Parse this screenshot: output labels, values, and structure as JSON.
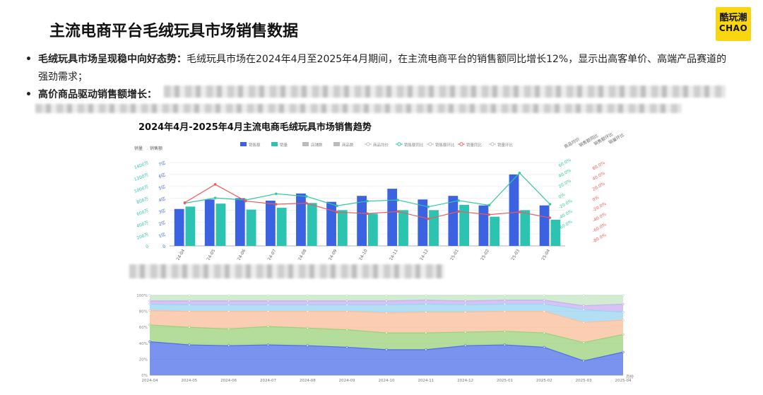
{
  "page": {
    "title": "主流电商平台毛绒玩具市场销售数据",
    "brand_logo": {
      "line1": "酷玩潮",
      "line2": "CHAO",
      "color": "#f8d711"
    },
    "bullets": [
      {
        "head": "毛绒玩具市场呈现稳中向好态势：",
        "text": "毛绒玩具市场在2024年4月至2025年4月期间，在主流电商平台的销售额同比增长12%，显示出高客单价、高端产品赛道的强劲需求；"
      },
      {
        "head": "高价商品驱动销售额增长：",
        "text": ""
      }
    ]
  },
  "chart_data": [
    {
      "type": "bar",
      "title": "2024年4月-2025年4月主流电商毛绒玩具市场销售趋势",
      "categories": [
        "2024-04",
        "2024-05",
        "2024-06",
        "2024-07",
        "2024-08",
        "2024-09",
        "2024-10",
        "2024-11",
        "2024-12",
        "2025-01",
        "2025-02",
        "2025-03",
        "2025-04"
      ],
      "legend": [
        "销售额",
        "销量",
        "店铺数",
        "商品数",
        "商品均价",
        "销售额同比",
        "销售额环比",
        "销量同比",
        "销量环比"
      ],
      "left_axes": [
        {
          "label": "销量",
          "ticks": [
            "0",
            "200万",
            "400万",
            "600万",
            "800万",
            "1000万",
            "1200万",
            "1400万"
          ],
          "color": "#2cc4b0"
        },
        {
          "label": "销售额",
          "ticks": [
            "0",
            "1亿",
            "2亿",
            "3亿",
            "4亿",
            "5亿",
            "6亿",
            "7亿"
          ],
          "color": "#3b62e0"
        }
      ],
      "right_axes": [
        {
          "label": "商品均价",
          "ticks": [],
          "color": "#888888"
        },
        {
          "label": "销售额同比",
          "ticks": [
            "-60.0%",
            "-40.0%",
            "-20.0%",
            "0%",
            "20.0%",
            "40.0%",
            "60.0%"
          ],
          "color": "#2fc9a0"
        },
        {
          "label": "销售额环比",
          "ticks": [
            "-80.0%",
            "-60.0%",
            "-40.0%",
            "-20.0%",
            "0%",
            "20.0%",
            "40.0%",
            "60.0%"
          ],
          "color": "#ee5a5a"
        },
        {
          "label": "销量环比",
          "ticks": [],
          "color": "#888888"
        }
      ],
      "series": [
        {
          "name": "销售额",
          "type": "bar",
          "color": "#3b62e0",
          "values": [
            3.1,
            3.9,
            4.0,
            3.8,
            4.4,
            3.7,
            4.2,
            4.8,
            3.9,
            4.2,
            3.4,
            6.0,
            3.4
          ]
        },
        {
          "name": "销量",
          "type": "bar",
          "color": "#2cc4b0",
          "values": [
            660,
            710,
            610,
            640,
            720,
            600,
            540,
            600,
            600,
            690,
            490,
            600,
            440
          ]
        },
        {
          "name": "销售额同比",
          "type": "line",
          "color": "#2fc9a0",
          "values": [
            2,
            12,
            8,
            20,
            15,
            -3,
            6,
            8,
            -5,
            7,
            -2,
            60,
            0
          ]
        },
        {
          "name": "销量同比",
          "type": "line",
          "color": "#ee5a5a",
          "values": [
            3,
            38,
            6,
            0,
            2,
            -15,
            -18,
            -14,
            -28,
            -14,
            -20,
            -15,
            -26
          ]
        }
      ],
      "grid": true,
      "legend_position": "top"
    },
    {
      "type": "area",
      "stacked_percent": true,
      "categories": [
        "2024-04",
        "2024-05",
        "2024-06",
        "2024-07",
        "2024-08",
        "2024-09",
        "2024-10",
        "2024-11",
        "2024-12",
        "2025-01",
        "2025-02",
        "2025-03",
        "2025-04"
      ],
      "y_ticks": [
        "0%",
        "20%",
        "40%",
        "60%",
        "80%",
        "100%"
      ],
      "x_axis_label": "月份",
      "series": [
        {
          "color": "#4d6fe8",
          "values": [
            42,
            38,
            37,
            38,
            37,
            35,
            32,
            32,
            37,
            38,
            35,
            18,
            29
          ]
        },
        {
          "color": "#9bd07a",
          "values": [
            21,
            22,
            21,
            23,
            22,
            22,
            21,
            21,
            17,
            17,
            18,
            23,
            22
          ]
        },
        {
          "color": "#f9be9a",
          "values": [
            18,
            20,
            22,
            19,
            21,
            23,
            25,
            26,
            25,
            25,
            27,
            25,
            18
          ]
        },
        {
          "color": "#9ad4f2",
          "values": [
            8,
            8,
            8,
            8,
            8,
            8,
            10,
            10,
            9,
            9,
            9,
            16,
            10
          ]
        },
        {
          "color": "#c6aff0",
          "values": [
            4,
            5,
            5,
            5,
            5,
            5,
            5,
            5,
            5,
            5,
            5,
            5,
            10
          ]
        },
        {
          "color": "#c3e5c3",
          "values": [
            7,
            7,
            7,
            7,
            7,
            7,
            7,
            6,
            7,
            6,
            6,
            13,
            11
          ]
        }
      ],
      "grid": true
    }
  ]
}
